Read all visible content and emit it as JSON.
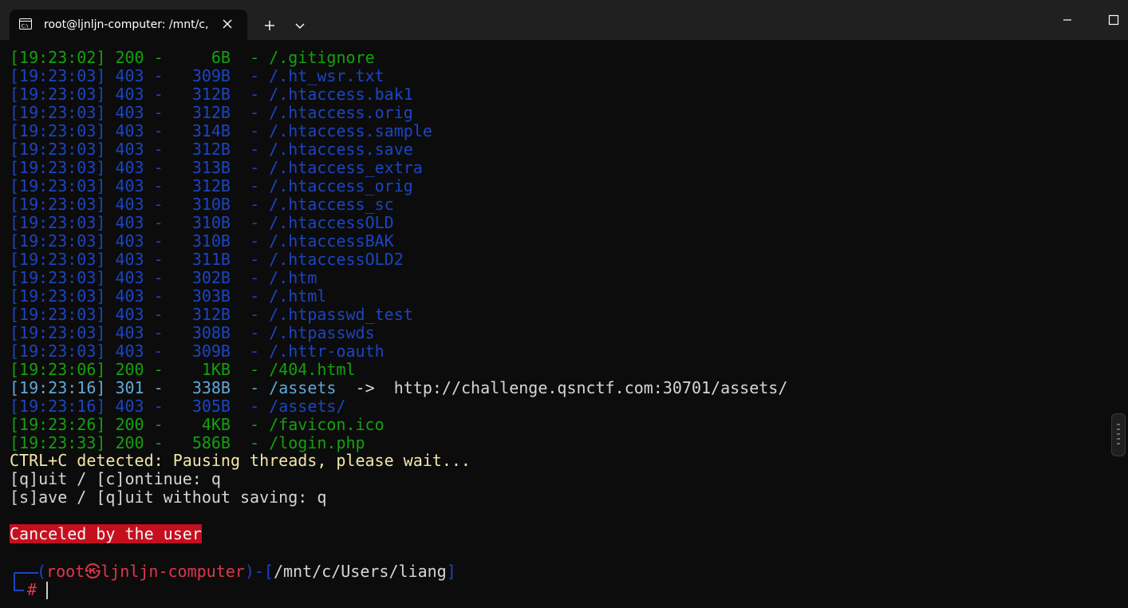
{
  "tab": {
    "title": "root@ljnljn-computer: /mnt/c,",
    "icon": "terminal-icon"
  },
  "window": {
    "minimize_icon": "minimize-icon",
    "maximize_icon": "maximize-icon"
  },
  "colors": {
    "status_200": "#13a10e",
    "status_403": "#1b45c2",
    "status_301": "#61a8d8",
    "warning": "#f3e6a6",
    "prompt_user": "#e0364b",
    "error_bg": "#c50f1f"
  },
  "terminal": {
    "scan_lines": [
      {
        "time": "[19:23:02]",
        "status": "200",
        "size": "6B",
        "path": "/.gitignore"
      },
      {
        "time": "[19:23:03]",
        "status": "403",
        "size": "309B",
        "path": "/.ht_wsr.txt"
      },
      {
        "time": "[19:23:03]",
        "status": "403",
        "size": "312B",
        "path": "/.htaccess.bak1"
      },
      {
        "time": "[19:23:03]",
        "status": "403",
        "size": "312B",
        "path": "/.htaccess.orig"
      },
      {
        "time": "[19:23:03]",
        "status": "403",
        "size": "314B",
        "path": "/.htaccess.sample"
      },
      {
        "time": "[19:23:03]",
        "status": "403",
        "size": "312B",
        "path": "/.htaccess.save"
      },
      {
        "time": "[19:23:03]",
        "status": "403",
        "size": "313B",
        "path": "/.htaccess_extra"
      },
      {
        "time": "[19:23:03]",
        "status": "403",
        "size": "312B",
        "path": "/.htaccess_orig"
      },
      {
        "time": "[19:23:03]",
        "status": "403",
        "size": "310B",
        "path": "/.htaccess_sc"
      },
      {
        "time": "[19:23:03]",
        "status": "403",
        "size": "310B",
        "path": "/.htaccessOLD"
      },
      {
        "time": "[19:23:03]",
        "status": "403",
        "size": "310B",
        "path": "/.htaccessBAK"
      },
      {
        "time": "[19:23:03]",
        "status": "403",
        "size": "311B",
        "path": "/.htaccessOLD2"
      },
      {
        "time": "[19:23:03]",
        "status": "403",
        "size": "302B",
        "path": "/.htm"
      },
      {
        "time": "[19:23:03]",
        "status": "403",
        "size": "303B",
        "path": "/.html"
      },
      {
        "time": "[19:23:03]",
        "status": "403",
        "size": "312B",
        "path": "/.htpasswd_test"
      },
      {
        "time": "[19:23:03]",
        "status": "403",
        "size": "308B",
        "path": "/.htpasswds"
      },
      {
        "time": "[19:23:03]",
        "status": "403",
        "size": "309B",
        "path": "/.httr-oauth"
      },
      {
        "time": "[19:23:06]",
        "status": "200",
        "size": "1KB",
        "path": "/404.html"
      },
      {
        "time": "[19:23:16]",
        "status": "301",
        "size": "338B",
        "path": "/assets",
        "redirect": "http://challenge.qsnctf.com:30701/assets/"
      },
      {
        "time": "[19:23:16]",
        "status": "403",
        "size": "305B",
        "path": "/assets/"
      },
      {
        "time": "[19:23:26]",
        "status": "200",
        "size": "4KB",
        "path": "/favicon.ico"
      },
      {
        "time": "[19:23:33]",
        "status": "200",
        "size": "586B",
        "path": "/login.php"
      }
    ],
    "ctrl_c": "CTRL+C detected: Pausing threads, please wait...",
    "quit_continue": "[q]uit / [c]ontinue: q",
    "save_quit": "[s]ave / [q]uit without saving: q",
    "canceled": "Canceled by the user",
    "prompt": {
      "open": "(",
      "user": "root",
      "at_symbol": "㉿",
      "host": "ljnljn-computer",
      "mid": ")-[",
      "cwd": "/mnt/c/Users/liang",
      "close": "]",
      "hash": "#"
    }
  }
}
